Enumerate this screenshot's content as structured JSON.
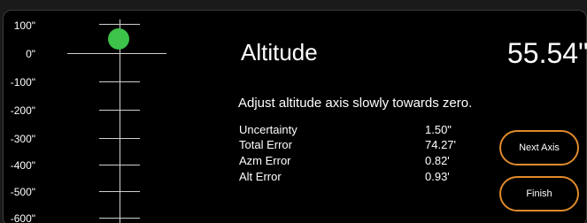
{
  "scale": {
    "labels": [
      "100\"",
      "0\"",
      "-100\"",
      "-200\"",
      "-300\"",
      "-400\"",
      "-500\"",
      "-600\""
    ],
    "indicator_color": "#3dc24a"
  },
  "altitude": {
    "title": "Altitude",
    "value": "55.54\""
  },
  "instruction": "Adjust altitude axis slowly towards zero.",
  "stats": [
    {
      "label": "Uncertainty",
      "value": "1.50\""
    },
    {
      "label": "Total Error",
      "value": "74.27'"
    },
    {
      "label": "Azm Error",
      "value": "0.82'"
    },
    {
      "label": "Alt Error",
      "value": "0.93'"
    }
  ],
  "buttons": {
    "next_axis": "Next Axis",
    "finish": "Finish"
  },
  "colors": {
    "accent": "#e08a2b",
    "background": "#000000"
  }
}
